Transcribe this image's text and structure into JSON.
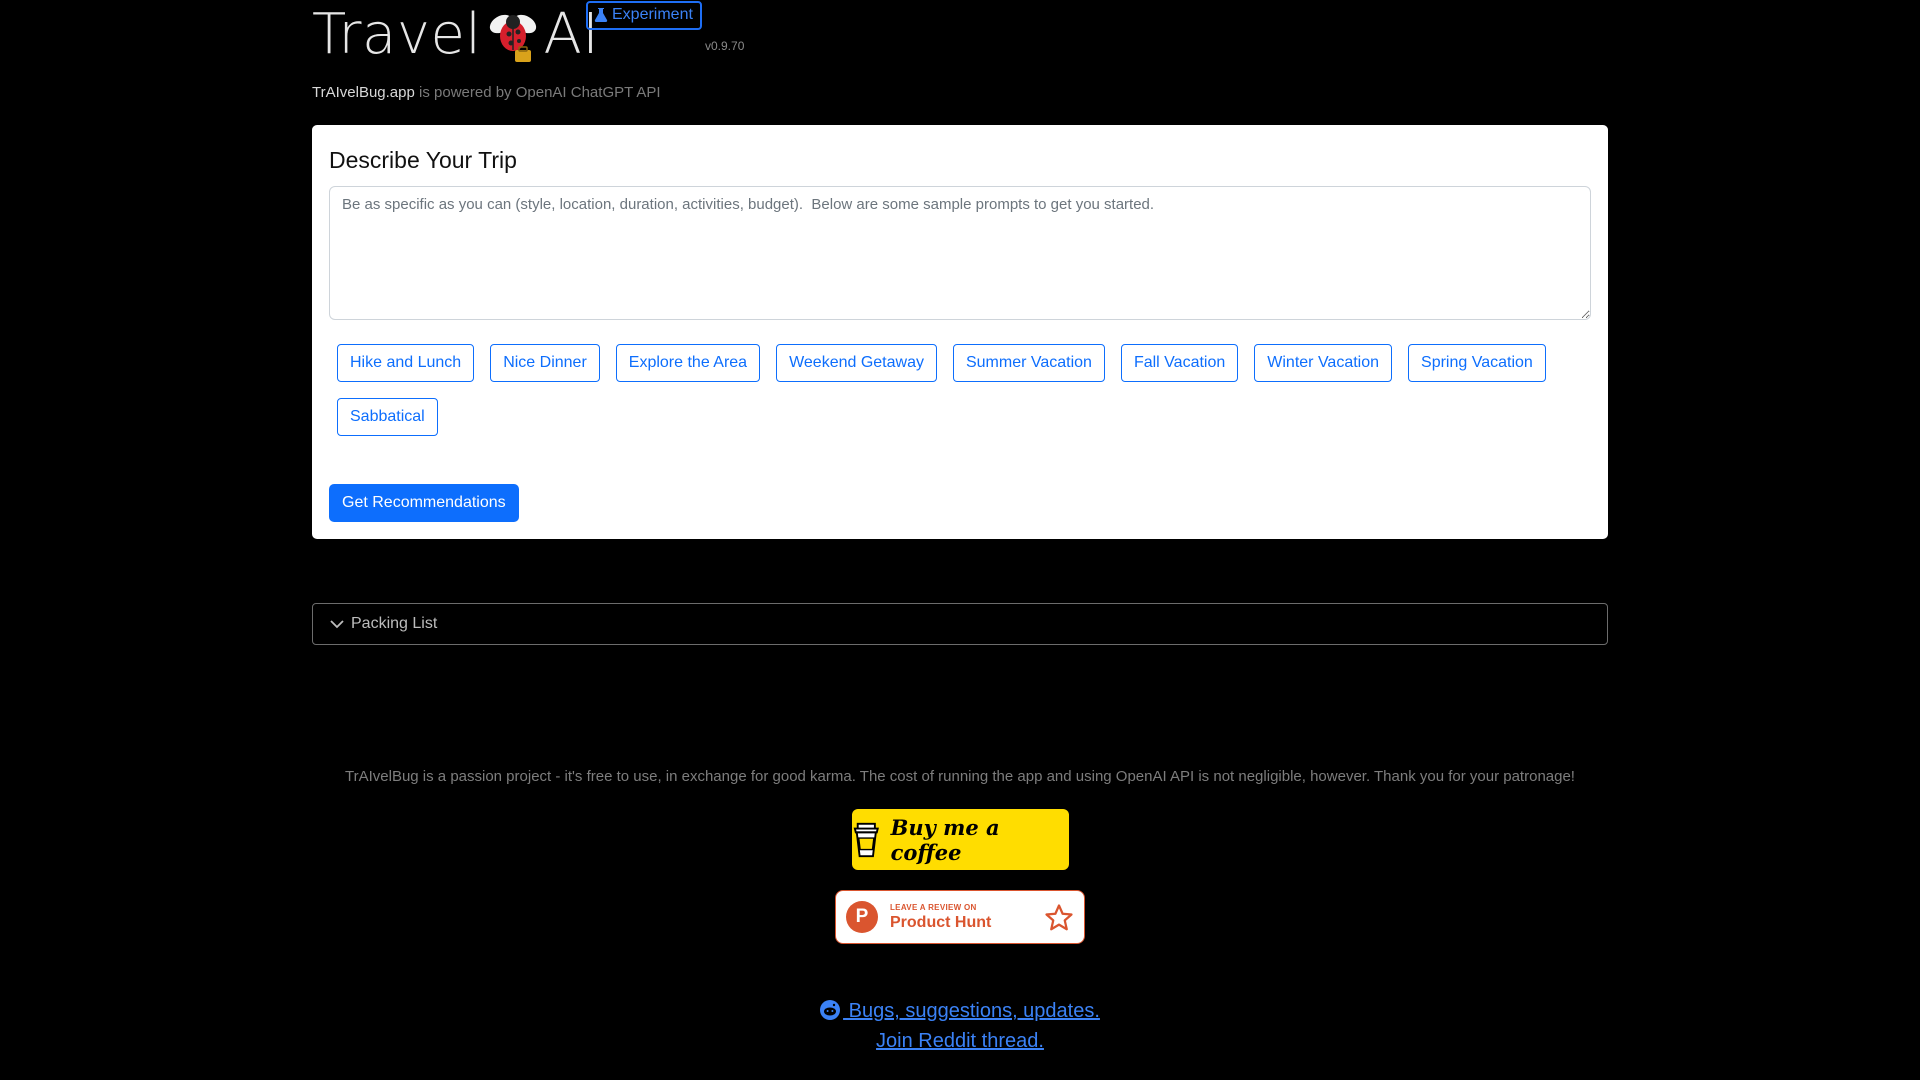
{
  "header": {
    "brand_left": "Travel",
    "brand_right": "AI",
    "badge": "Experiment",
    "version": "v0.9.70",
    "powered_app": "TrAIvelBug.app",
    "powered_text": " is powered by OpenAI ChatGPT API"
  },
  "trip": {
    "title": "Describe Your Trip",
    "placeholder": "Be as specific as you can (style, location, duration, activities, budget).  Below are some sample prompts to get you started.",
    "value": "",
    "chips": [
      "Hike and Lunch",
      "Nice Dinner",
      "Explore the Area",
      "Weekend Getaway",
      "Summer Vacation",
      "Fall Vacation",
      "Winter Vacation",
      "Spring Vacation",
      "Sabbatical"
    ],
    "submit": "Get Recommendations"
  },
  "packing": {
    "label": "Packing List"
  },
  "footer": {
    "note": "TrAIvelBug is a passion project - it's free to use, in exchange for good karma. The cost of running the app and using OpenAI API is not negligible, however. Thank you for your patronage!",
    "coffee": "Buy me a coffee",
    "ph_small": "LEAVE A REVIEW ON",
    "ph_big": "Product Hunt",
    "ph_logo": "P",
    "link1": " Bugs, suggestions, updates.",
    "link2": "Join Reddit thread."
  },
  "colors": {
    "accent": "#0d6efd",
    "coffee": "#ffdd00",
    "producthunt": "#da552f"
  }
}
